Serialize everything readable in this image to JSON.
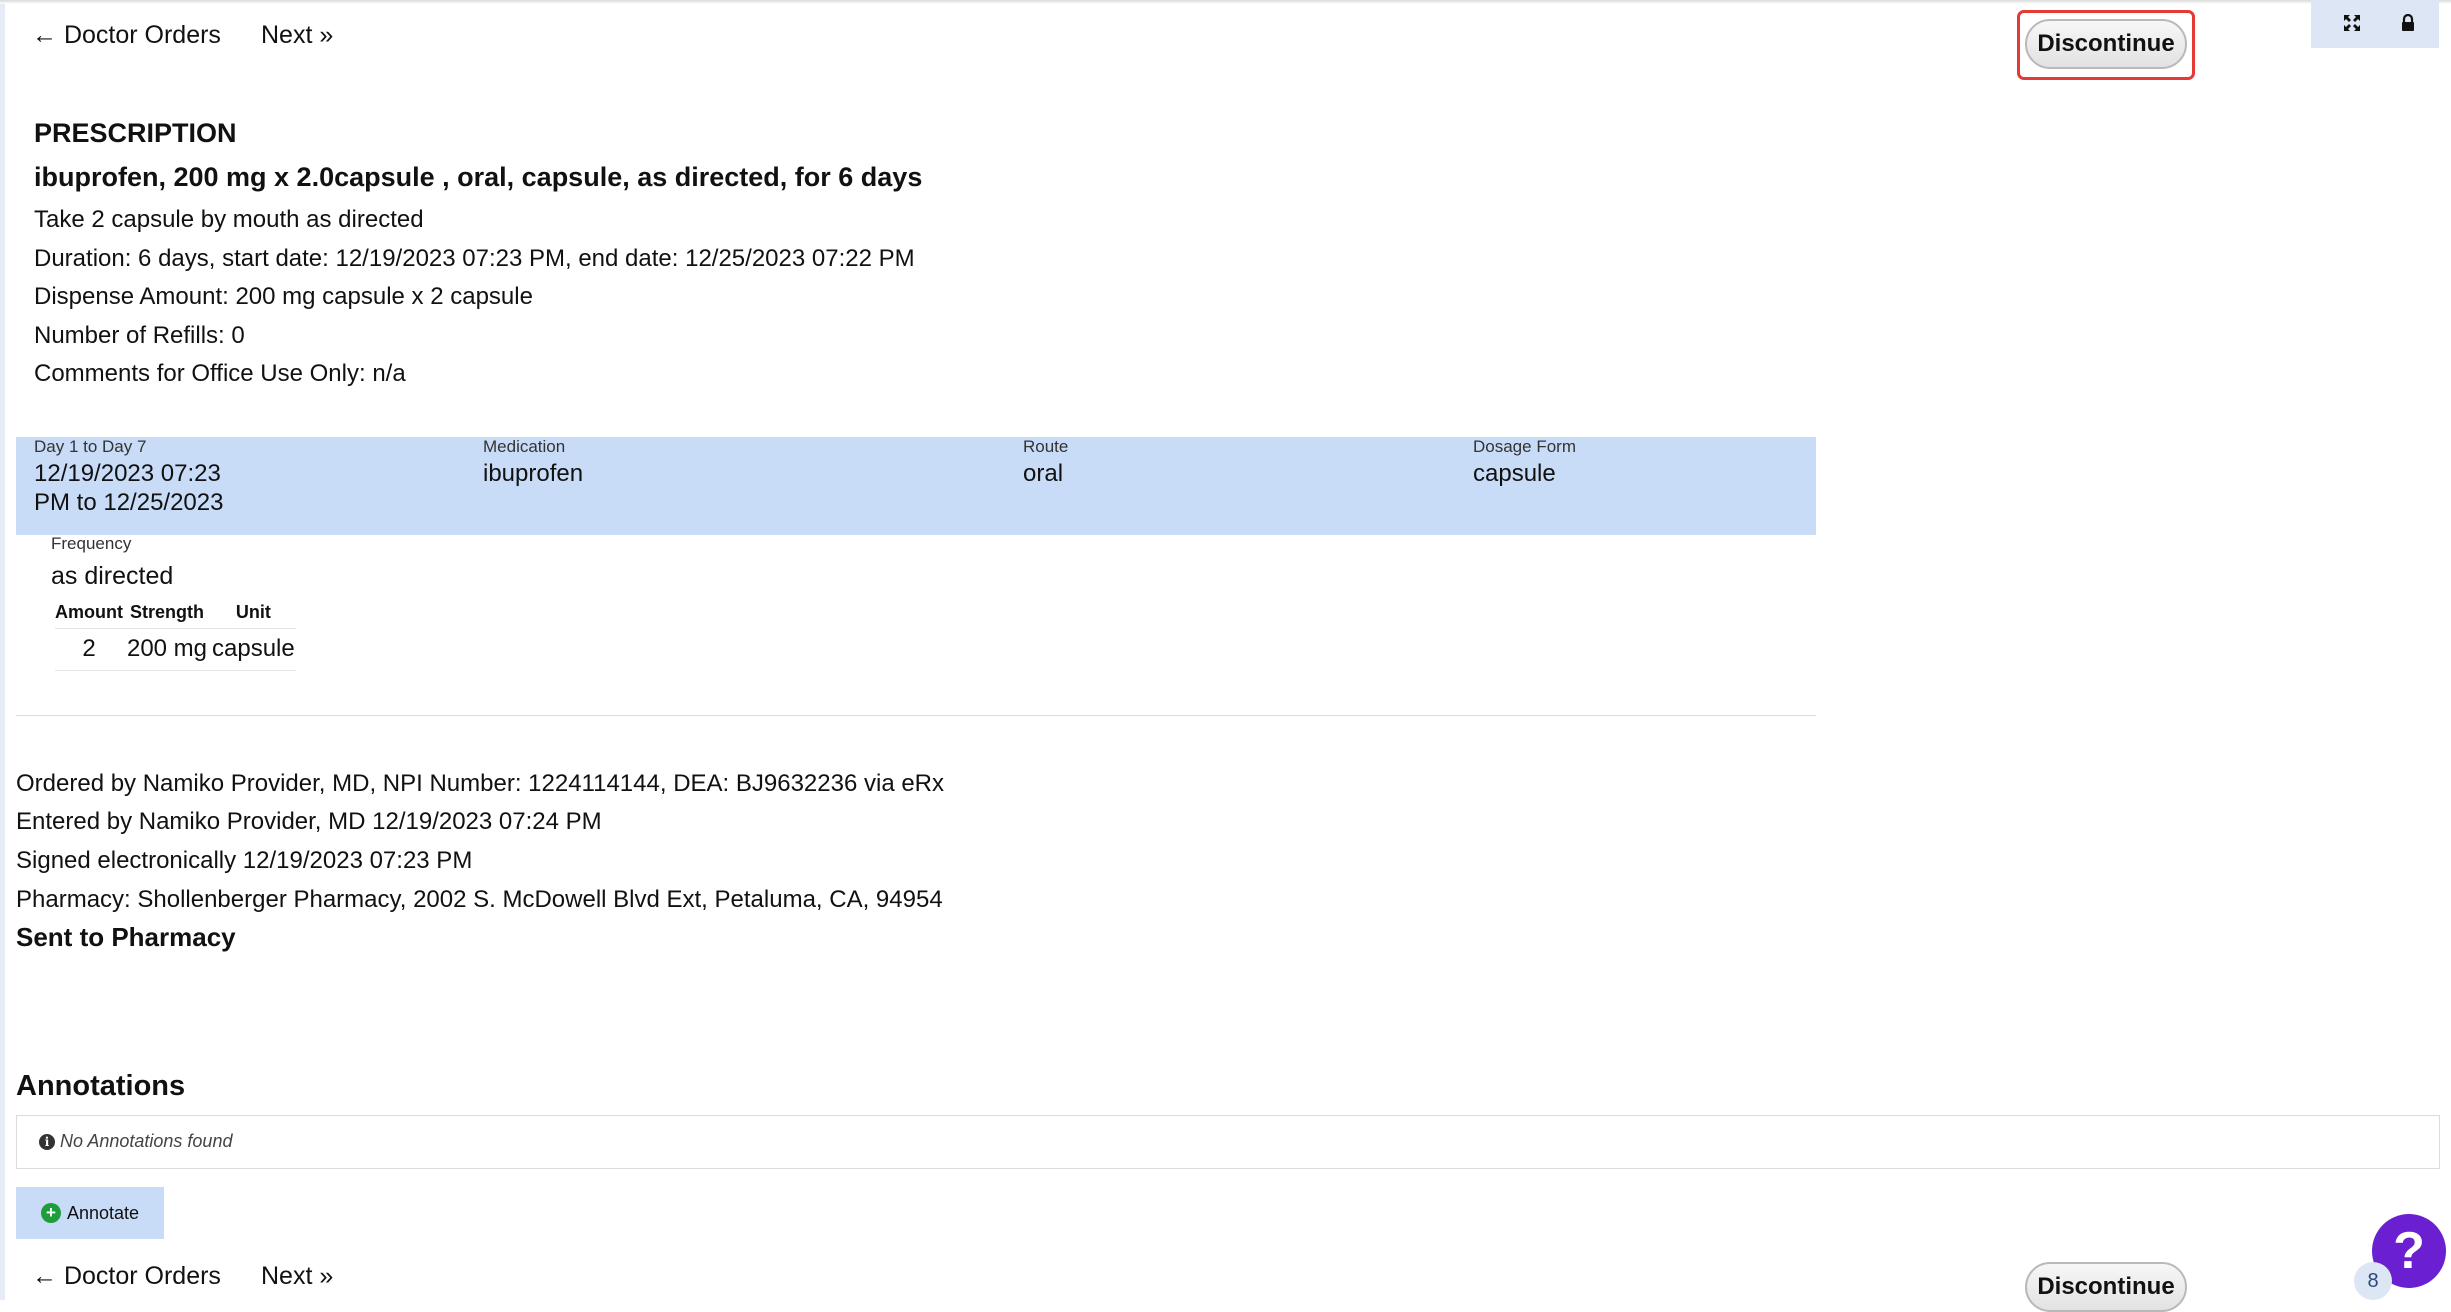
{
  "nav": {
    "back_label": "← Doctor Orders",
    "next_label": "Next »",
    "discontinue_label": "Discontinue"
  },
  "prescription": {
    "heading": "PRESCRIPTION",
    "title": "ibuprofen, 200 mg x 2.0capsule , oral, capsule, as directed, for 6 days",
    "instructions": "Take 2 capsule by mouth as directed",
    "duration": "Duration: 6 days, start date: 12/19/2023 07:23 PM, end date: 12/25/2023 07:22 PM",
    "dispense": "Dispense Amount: 200 mg capsule x 2 capsule",
    "refills": "Number of Refills: 0",
    "comments": "Comments for Office Use Only: n/a"
  },
  "detail": {
    "period_label": "Day 1 to Day 7",
    "period_value_line1": "12/19/2023 07:23",
    "period_value_line2": "PM to 12/25/2023",
    "medication_label": "Medication",
    "medication_value": "ibuprofen",
    "route_label": "Route",
    "route_value": "oral",
    "form_label": "Dosage Form",
    "form_value": "capsule",
    "frequency_label": "Frequency",
    "frequency_value": "as directed",
    "dose_table": {
      "headers": [
        "Amount",
        "Strength",
        "Unit"
      ],
      "rows": [
        [
          "2",
          "200 mg",
          "capsule"
        ]
      ]
    }
  },
  "order_info": {
    "ordered_by": "Ordered by Namiko Provider, MD, NPI Number: 1224114144, DEA: BJ9632236 via eRx",
    "entered_by": "Entered by Namiko Provider, MD 12/19/2023 07:24 PM",
    "signed": "Signed electronically 12/19/2023 07:23 PM",
    "pharmacy": "Pharmacy: Shollenberger Pharmacy, 2002 S. McDowell Blvd Ext, Petaluma, CA, 94954",
    "status": "Sent to Pharmacy"
  },
  "annotations": {
    "heading": "Annotations",
    "empty_text": "No Annotations found",
    "annotate_label": "Annotate"
  },
  "help": {
    "symbol": "?",
    "badge_count": "8"
  },
  "icons": {
    "expand": "expand-icon",
    "lock": "lock-icon",
    "info": "info-icon",
    "plus": "plus-circle-icon"
  },
  "colors": {
    "band": "#c9dcf7",
    "highlight": "#e53935",
    "help": "#6a1fd0",
    "plus": "#1e9e3a"
  }
}
